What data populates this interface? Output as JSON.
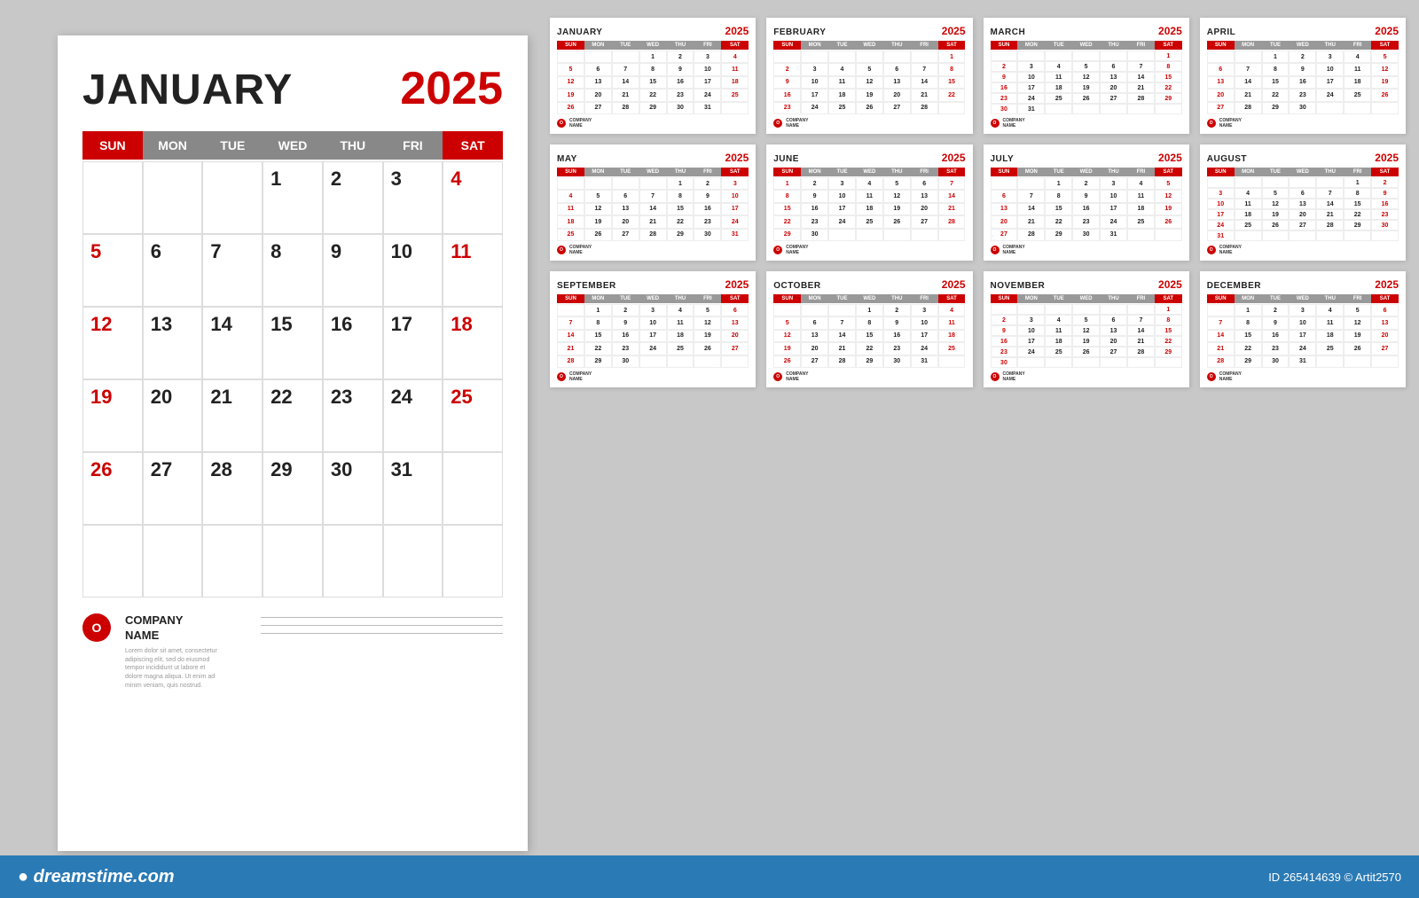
{
  "main_calendar": {
    "month": "JANUARY",
    "year": "2025",
    "days_header": [
      "SUN",
      "MON",
      "TUE",
      "WED",
      "THU",
      "FRI",
      "SAT"
    ],
    "weeks": [
      [
        "",
        "",
        "",
        "1",
        "2",
        "3",
        "4"
      ],
      [
        "5",
        "6",
        "7",
        "8",
        "9",
        "10",
        "11"
      ],
      [
        "12",
        "13",
        "14",
        "15",
        "16",
        "17",
        "18"
      ],
      [
        "19",
        "20",
        "21",
        "22",
        "23",
        "24",
        "25"
      ],
      [
        "26",
        "27",
        "28",
        "29",
        "30",
        "31",
        ""
      ],
      [
        "",
        "",
        "",
        "",
        "",
        "",
        ""
      ]
    ],
    "red_cells": [
      "4",
      "11",
      "18",
      "25",
      "5",
      "12",
      "19",
      "26"
    ],
    "company": {
      "logo_letter": "O",
      "name": "COMPANY\nNAME",
      "desc": "Lorem dolor sit amet, consectetur\nadipiscing elit, sed do eiusmod\ntempor incididunt ut labore et\ndolore magna aliqua. Ut enim ad\nminim veniam, quis nostrud."
    }
  },
  "small_calendars": [
    {
      "month": "JANUARY",
      "year": "2025",
      "weeks": [
        [
          "",
          "",
          "",
          "1",
          "2",
          "3",
          "4"
        ],
        [
          "5",
          "6",
          "7",
          "8",
          "9",
          "10",
          "11"
        ],
        [
          "12",
          "13",
          "14",
          "15",
          "16",
          "17",
          "18"
        ],
        [
          "19",
          "20",
          "21",
          "22",
          "23",
          "24",
          "25"
        ],
        [
          "26",
          "27",
          "28",
          "29",
          "30",
          "31",
          ""
        ]
      ],
      "red": [
        "4",
        "11",
        "18",
        "25",
        "5",
        "12",
        "19",
        "26"
      ]
    },
    {
      "month": "FEBRUARY",
      "year": "2025",
      "weeks": [
        [
          "",
          "",
          "",
          "",
          "",
          "",
          "1"
        ],
        [
          "2",
          "3",
          "4",
          "5",
          "6",
          "7",
          "8"
        ],
        [
          "9",
          "10",
          "11",
          "12",
          "13",
          "14",
          "15"
        ],
        [
          "16",
          "17",
          "18",
          "19",
          "20",
          "21",
          "22"
        ],
        [
          "23",
          "24",
          "25",
          "26",
          "27",
          "28",
          ""
        ]
      ],
      "red": [
        "1",
        "8",
        "15",
        "22",
        "2",
        "9",
        "16",
        "23"
      ]
    },
    {
      "month": "MARCH",
      "year": "2025",
      "weeks": [
        [
          "",
          "",
          "",
          "",
          "",
          "",
          "1"
        ],
        [
          "2",
          "3",
          "4",
          "5",
          "6",
          "7",
          "8"
        ],
        [
          "9",
          "10",
          "11",
          "12",
          "13",
          "14",
          "15"
        ],
        [
          "16",
          "17",
          "18",
          "19",
          "20",
          "21",
          "22"
        ],
        [
          "23",
          "24",
          "25",
          "26",
          "27",
          "28",
          "29"
        ],
        [
          "30",
          "31",
          "",
          "",
          "",
          "",
          ""
        ]
      ],
      "red": [
        "1",
        "8",
        "15",
        "22",
        "29",
        "2",
        "9",
        "16",
        "23",
        "30"
      ]
    },
    {
      "month": "APRIL",
      "year": "2025",
      "weeks": [
        [
          "",
          "",
          "1",
          "2",
          "3",
          "4",
          "5"
        ],
        [
          "6",
          "7",
          "8",
          "9",
          "10",
          "11",
          "12"
        ],
        [
          "13",
          "14",
          "15",
          "16",
          "17",
          "18",
          "19"
        ],
        [
          "20",
          "21",
          "22",
          "23",
          "24",
          "25",
          "26"
        ],
        [
          "27",
          "28",
          "29",
          "30",
          "",
          "",
          ""
        ]
      ],
      "red": [
        "5",
        "12",
        "19",
        "26",
        "6",
        "13",
        "20",
        "27"
      ]
    },
    {
      "month": "MAY",
      "year": "2025",
      "weeks": [
        [
          "",
          "",
          "",
          "",
          "1",
          "2",
          "3"
        ],
        [
          "4",
          "5",
          "6",
          "7",
          "8",
          "9",
          "10"
        ],
        [
          "11",
          "12",
          "13",
          "14",
          "15",
          "16",
          "17"
        ],
        [
          "18",
          "19",
          "20",
          "21",
          "22",
          "23",
          "24"
        ],
        [
          "25",
          "26",
          "27",
          "28",
          "29",
          "30",
          "31"
        ]
      ],
      "red": [
        "3",
        "10",
        "17",
        "24",
        "31",
        "4",
        "11",
        "18",
        "25"
      ]
    },
    {
      "month": "JUNE",
      "year": "2025",
      "weeks": [
        [
          "1",
          "2",
          "3",
          "4",
          "5",
          "6",
          "7"
        ],
        [
          "8",
          "9",
          "10",
          "11",
          "12",
          "13",
          "14"
        ],
        [
          "15",
          "16",
          "17",
          "18",
          "19",
          "20",
          "21"
        ],
        [
          "22",
          "23",
          "24",
          "25",
          "26",
          "27",
          "28"
        ],
        [
          "29",
          "30",
          "",
          "",
          "",
          "",
          ""
        ]
      ],
      "red": [
        "7",
        "14",
        "21",
        "28",
        "1",
        "8",
        "15",
        "22",
        "29"
      ]
    },
    {
      "month": "JULY",
      "year": "2025",
      "weeks": [
        [
          "",
          "",
          "1",
          "2",
          "3",
          "4",
          "5"
        ],
        [
          "6",
          "7",
          "8",
          "9",
          "10",
          "11",
          "12"
        ],
        [
          "13",
          "14",
          "15",
          "16",
          "17",
          "18",
          "19"
        ],
        [
          "20",
          "21",
          "22",
          "23",
          "24",
          "25",
          "26"
        ],
        [
          "27",
          "28",
          "29",
          "30",
          "31",
          "",
          ""
        ]
      ],
      "red": [
        "5",
        "12",
        "19",
        "26",
        "6",
        "13",
        "20",
        "27"
      ]
    },
    {
      "month": "AUGUST",
      "year": "2025",
      "weeks": [
        [
          "",
          "",
          "",
          "",
          "",
          "1",
          "2"
        ],
        [
          "3",
          "4",
          "5",
          "6",
          "7",
          "8",
          "9"
        ],
        [
          "10",
          "11",
          "12",
          "13",
          "14",
          "15",
          "16"
        ],
        [
          "17",
          "18",
          "19",
          "20",
          "21",
          "22",
          "23"
        ],
        [
          "24",
          "25",
          "26",
          "27",
          "28",
          "29",
          "30"
        ],
        [
          "31",
          "",
          "",
          "",
          "",
          "",
          ""
        ]
      ],
      "red": [
        "2",
        "9",
        "16",
        "23",
        "30",
        "3",
        "10",
        "17",
        "24",
        "31"
      ]
    },
    {
      "month": "SEPTEMBER",
      "year": "2025",
      "weeks": [
        [
          "",
          "1",
          "2",
          "3",
          "4",
          "5",
          "6"
        ],
        [
          "7",
          "8",
          "9",
          "10",
          "11",
          "12",
          "13"
        ],
        [
          "14",
          "15",
          "16",
          "17",
          "18",
          "19",
          "20"
        ],
        [
          "21",
          "22",
          "23",
          "24",
          "25",
          "26",
          "27"
        ],
        [
          "28",
          "29",
          "30",
          "",
          "",
          "",
          ""
        ]
      ],
      "red": [
        "6",
        "13",
        "20",
        "27",
        "7",
        "14",
        "21",
        "28"
      ]
    },
    {
      "month": "OCTOBER",
      "year": "2025",
      "weeks": [
        [
          "",
          "",
          "",
          "1",
          "2",
          "3",
          "4"
        ],
        [
          "5",
          "6",
          "7",
          "8",
          "9",
          "10",
          "11"
        ],
        [
          "12",
          "13",
          "14",
          "15",
          "16",
          "17",
          "18"
        ],
        [
          "19",
          "20",
          "21",
          "22",
          "23",
          "24",
          "25"
        ],
        [
          "26",
          "27",
          "28",
          "29",
          "30",
          "31",
          ""
        ]
      ],
      "red": [
        "4",
        "11",
        "18",
        "25",
        "5",
        "12",
        "19",
        "26"
      ]
    },
    {
      "month": "NOVEMBER",
      "year": "2025",
      "weeks": [
        [
          "",
          "",
          "",
          "",
          "",
          "",
          "1"
        ],
        [
          "2",
          "3",
          "4",
          "5",
          "6",
          "7",
          "8"
        ],
        [
          "9",
          "10",
          "11",
          "12",
          "13",
          "14",
          "15"
        ],
        [
          "16",
          "17",
          "18",
          "19",
          "20",
          "21",
          "22"
        ],
        [
          "23",
          "24",
          "25",
          "26",
          "27",
          "28",
          "29"
        ],
        [
          "30",
          "",
          "",
          "",
          "",
          "",
          ""
        ]
      ],
      "red": [
        "1",
        "8",
        "15",
        "22",
        "29",
        "2",
        "9",
        "16",
        "23",
        "30"
      ]
    },
    {
      "month": "DECEMBER",
      "year": "2025",
      "weeks": [
        [
          "",
          "1",
          "2",
          "3",
          "4",
          "5",
          "6"
        ],
        [
          "7",
          "8",
          "9",
          "10",
          "11",
          "12",
          "13"
        ],
        [
          "14",
          "15",
          "16",
          "17",
          "18",
          "19",
          "20"
        ],
        [
          "21",
          "22",
          "23",
          "24",
          "25",
          "26",
          "27"
        ],
        [
          "28",
          "29",
          "30",
          "31",
          "",
          "",
          ""
        ]
      ],
      "red": [
        "6",
        "13",
        "20",
        "27",
        "7",
        "14",
        "21",
        "28"
      ]
    }
  ],
  "dreamstime": {
    "logo": "dreamstime.com",
    "id": "ID 265414639 © Artit2570"
  },
  "days_header": [
    "SUN",
    "MON",
    "TUE",
    "WED",
    "THU",
    "FRI",
    "SAT"
  ]
}
